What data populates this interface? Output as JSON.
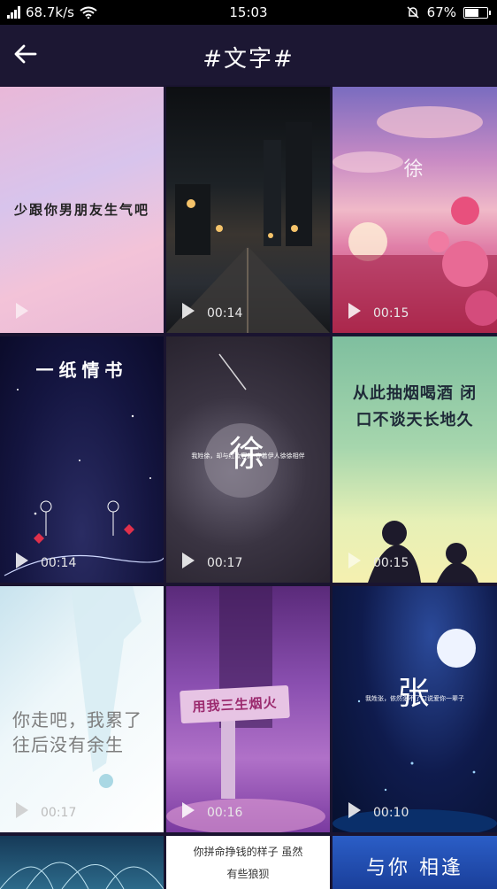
{
  "status": {
    "speed": "68.7k/s",
    "time": "15:03",
    "battery": "67%",
    "battery_level": 0.67
  },
  "header": {
    "title": "#文字#"
  },
  "videos": [
    {
      "caption": "少跟你男朋友生气吧",
      "duration": ""
    },
    {
      "caption": "",
      "duration": "00:14"
    },
    {
      "caption": "徐",
      "duration": "00:15"
    },
    {
      "caption": "一纸情书",
      "duration": "00:14"
    },
    {
      "caption": "徐",
      "subcaption": "我姓徐，却与红妆容颜 守着伊人徐徐相伴",
      "duration": "00:17"
    },
    {
      "caption": "从此抽烟喝酒 闭口不谈天长地久",
      "duration": "00:15"
    },
    {
      "caption": "你走吧，我累了 往后没有余生",
      "duration": "00:17"
    },
    {
      "caption": "用我三生烟火",
      "duration": "00:16"
    },
    {
      "caption": "张",
      "subcaption": "我姓张，依然张不了口说爱你一辈子",
      "duration": "00:10"
    },
    {
      "caption": "",
      "duration": ""
    },
    {
      "caption": "你拼命挣钱的样子 虽然有些狼狈",
      "duration": ""
    },
    {
      "caption": "与你 相逢",
      "duration": ""
    }
  ]
}
